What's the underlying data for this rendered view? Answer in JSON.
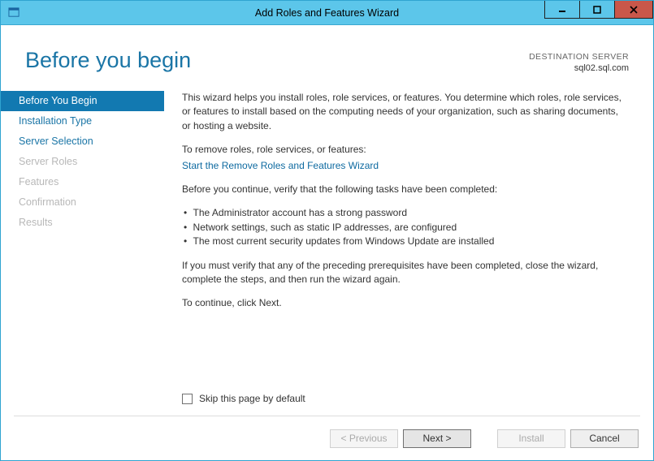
{
  "window": {
    "title": "Add Roles and Features Wizard"
  },
  "header": {
    "title": "Before you begin",
    "destination_label": "DESTINATION SERVER",
    "destination_server": "sql02.sql.com"
  },
  "sidebar": {
    "items": [
      {
        "label": "Before You Begin",
        "state": "selected"
      },
      {
        "label": "Installation Type",
        "state": "enabled"
      },
      {
        "label": "Server Selection",
        "state": "enabled"
      },
      {
        "label": "Server Roles",
        "state": "disabled"
      },
      {
        "label": "Features",
        "state": "disabled"
      },
      {
        "label": "Confirmation",
        "state": "disabled"
      },
      {
        "label": "Results",
        "state": "disabled"
      }
    ]
  },
  "content": {
    "intro": "This wizard helps you install roles, role services, or features. You determine which roles, role services, or features to install based on the computing needs of your organization, such as sharing documents, or hosting a website.",
    "remove_label": "To remove roles, role services, or features:",
    "remove_link": "Start the Remove Roles and Features Wizard",
    "verify_label": "Before you continue, verify that the following tasks have been completed:",
    "bullets": [
      "The Administrator account has a strong password",
      "Network settings, such as static IP addresses, are configured",
      "The most current security updates from Windows Update are installed"
    ],
    "must_verify": "If you must verify that any of the preceding prerequisites have been completed, close the wizard, complete the steps, and then run the wizard again.",
    "continue_text": "To continue, click Next.",
    "skip_label": "Skip this page by default"
  },
  "footer": {
    "previous": "< Previous",
    "next": "Next >",
    "install": "Install",
    "cancel": "Cancel"
  }
}
